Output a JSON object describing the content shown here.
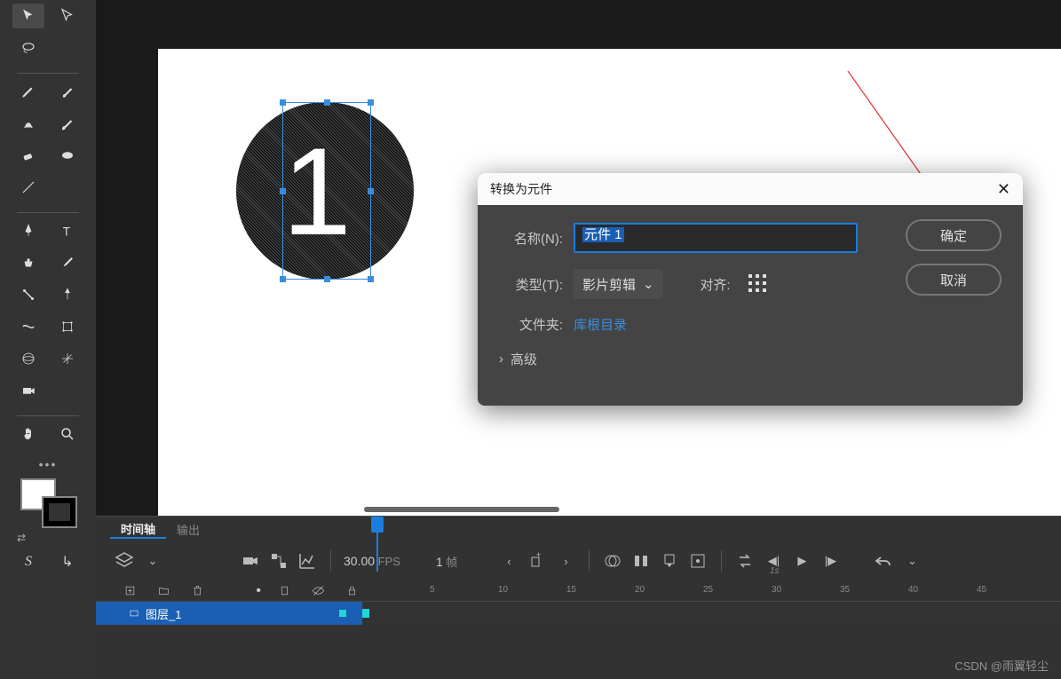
{
  "toolbar": {
    "tools": {
      "selection": "selection",
      "subselection": "subselection",
      "lasso": "lasso",
      "pencil": "pencil",
      "brush": "brush",
      "fluid": "fluid",
      "paint": "paint",
      "eraser": "eraser",
      "oval": "oval",
      "line": "line",
      "pen": "pen",
      "text": "text",
      "ink": "ink",
      "eyedropper": "eyedropper",
      "bone": "bone",
      "pin": "pin",
      "width": "width",
      "transform": "transform",
      "rotate3d": "rotate3d",
      "orbit": "orbit",
      "camera": "camera",
      "hand": "hand",
      "zoom": "zoom",
      "snap": "S",
      "smooth": "↳"
    }
  },
  "canvas": {
    "big_number": "1"
  },
  "dialog": {
    "title": "转换为元件",
    "name_label": "名称(N):",
    "name_value": "元件 1",
    "type_label": "类型(T):",
    "type_value": "影片剪辑",
    "align_label": "对齐:",
    "folder_label": "文件夹:",
    "folder_value": "库根目录",
    "advanced": "高级",
    "ok": "确定",
    "cancel": "取消"
  },
  "timeline": {
    "tabs": {
      "timeline": "时间轴",
      "output": "输出"
    },
    "fps_value": "30.00",
    "fps_label": "FPS",
    "frame_num": "1",
    "frame_label": "帧",
    "ruler_1s": "1s",
    "ruler_marks": [
      "5",
      "10",
      "15",
      "20",
      "25",
      "30",
      "35",
      "40",
      "45"
    ],
    "layer_name": "图层_1"
  },
  "watermark": "CSDN @雨翼轻尘"
}
